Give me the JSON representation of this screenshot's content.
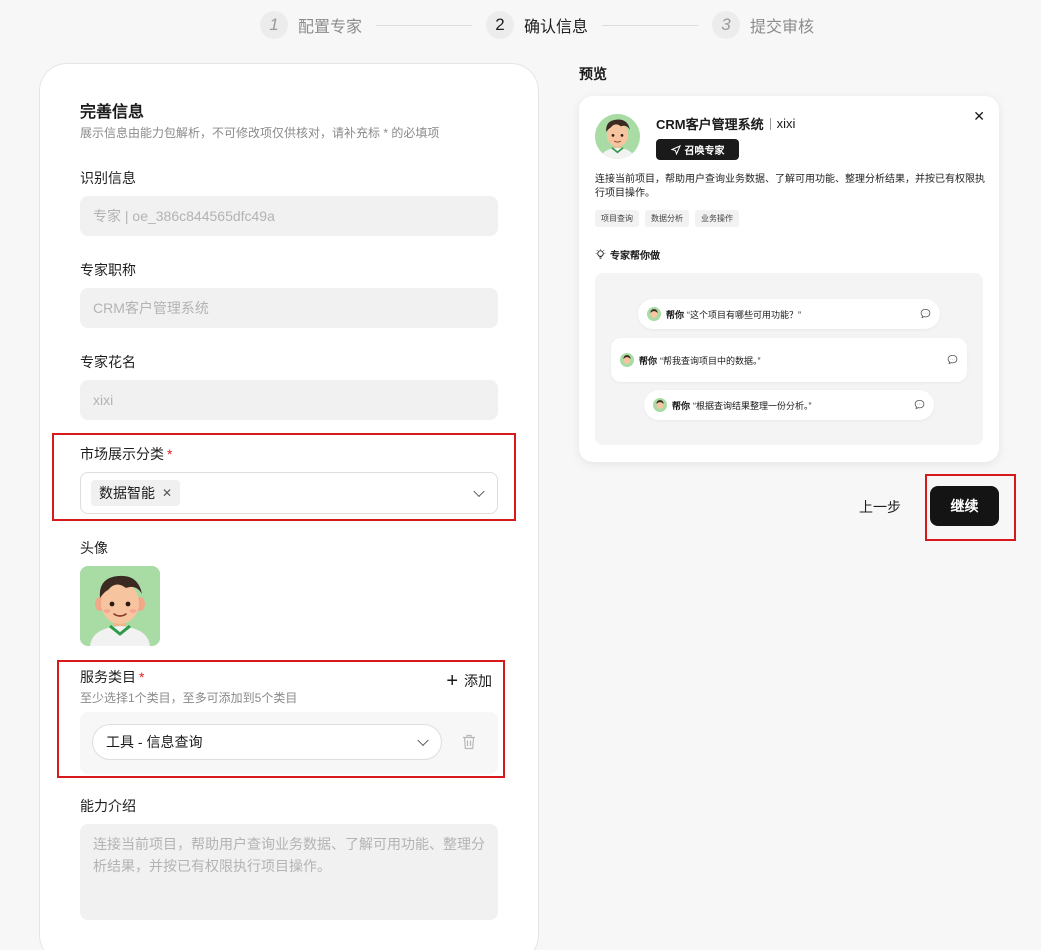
{
  "steps": [
    {
      "num": "1",
      "label": "配置专家"
    },
    {
      "num": "2",
      "label": "确认信息"
    },
    {
      "num": "3",
      "label": "提交审核"
    }
  ],
  "form": {
    "title": "完善信息",
    "desc": "展示信息由能力包解析，不可修改项仅供核对，请补充标 * 的必填项",
    "id_label": "识别信息",
    "id_value": "专家 | oe_386c844565dfc49a",
    "job_label": "专家职称",
    "job_value": "CRM客户管理系统",
    "nick_label": "专家花名",
    "nick_value": "xixi",
    "market_label": "市场展示分类",
    "market_tag": "数据智能",
    "avatar_label": "头像",
    "service_label": "服务类目",
    "service_desc": "至少选择1个类目，至多可添加到5个类目",
    "add_label": "添加",
    "service_value": "工具 - 信息查询",
    "intro_label": "能力介绍",
    "intro_value": "连接当前项目，帮助用户查询业务数据、了解可用功能、整理分析结果，并按已有权限执行项目操作。",
    "required_mark": "*"
  },
  "preview": {
    "label": "预览",
    "title": "CRM客户管理系统",
    "nick": "xixi",
    "call_label": "召唤专家",
    "desc": "连接当前项目，帮助用户查询业务数据、了解可用功能、整理分析结果，并按已有权限执行项目操作。",
    "tags": [
      "项目查询",
      "数据分析",
      "业务操作"
    ],
    "help_title": "专家帮你做",
    "help_prefix": "帮你",
    "prompts": [
      "“这个项目有哪些可用功能？”",
      "“帮我查询项目中的数据。”",
      "“根据查询结果整理一份分析。”"
    ]
  },
  "actions": {
    "prev": "上一步",
    "next": "继续"
  },
  "colors": {
    "accent_dark": "#141414",
    "highlight_red": "#d7191c",
    "required_red": "#e02020"
  }
}
